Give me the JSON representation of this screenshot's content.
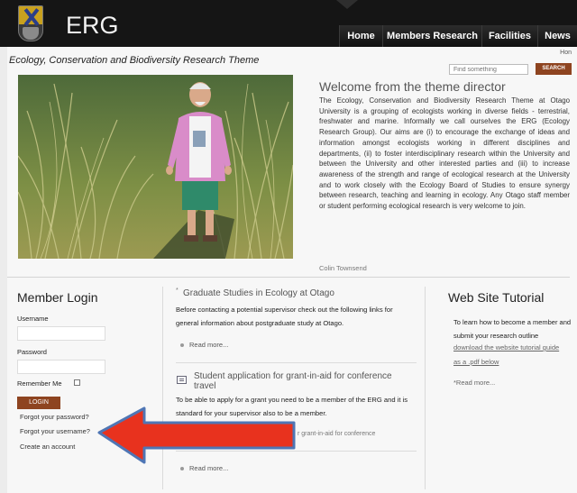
{
  "header": {
    "brand": "ERG",
    "nav": [
      {
        "label": "Home"
      },
      {
        "label": "Members Research"
      },
      {
        "label": "Facilities"
      },
      {
        "label": "News"
      }
    ]
  },
  "theme_title": "Ecology, Conservation and Biodiversity Research Theme",
  "top_link": "Hon",
  "search": {
    "placeholder": "Find something",
    "button_label": "SEARCH"
  },
  "welcome": {
    "heading": "Welcome from the theme director",
    "body": "The Ecology, Conservation and Biodiversity Research Theme at Otago University is a grouping of ecologists working in diverse fields - terrestrial, freshwater and marine. Informally we call ourselves the ERG (Ecology Research Group). Our aims are (i) to encourage the exchange of ideas and information amongst ecologists working in different disciplines and departments, (ii) to foster interdisciplinary research within the University and between the University and other interested parties and (iii) to increase awareness of the strength and range of ecological research at the University and to work closely with the Ecology Board of Studies to ensure synergy between research, teaching and learning in ecology. Any Otago staff member or student performing ecological research is very welcome to join.",
    "signoff": "Colin Townsend"
  },
  "login": {
    "heading": "Member Login",
    "username_label": "Username",
    "password_label": "Password",
    "remember_label": "Remember Me",
    "button_label": "LOGIN",
    "forgot_password": "Forgot your password?",
    "forgot_username": "Forgot your username?",
    "create_account": "Create an account"
  },
  "graduate": {
    "heading": "Graduate Studies in Ecology at Otago",
    "text": "Before contacting a potential supervisor check out the following links for general information about postgraduate study at Otago.",
    "read_more": "Read more..."
  },
  "grant": {
    "heading": "Student application for grant-in-aid for conference travel",
    "text": "To be able to apply for a grant you need to be a member of the ERG and it is standard for your supervisor also to be a member.",
    "link": "r grant-in-aid for conference",
    "read_more": "Read more..."
  },
  "tutorial": {
    "heading": "Web Site Tutorial",
    "text": "To learn how to become a member and submit your research outline",
    "link_line1": "download the website tutorial guide",
    "link_line2": "as a .pdf below",
    "read_more": "*Read more..."
  },
  "colors": {
    "header_bg": "#151515",
    "accent_button": "#8e4420",
    "annotation_arrow": "#e8321e",
    "annotation_outline": "#4f76b5"
  }
}
